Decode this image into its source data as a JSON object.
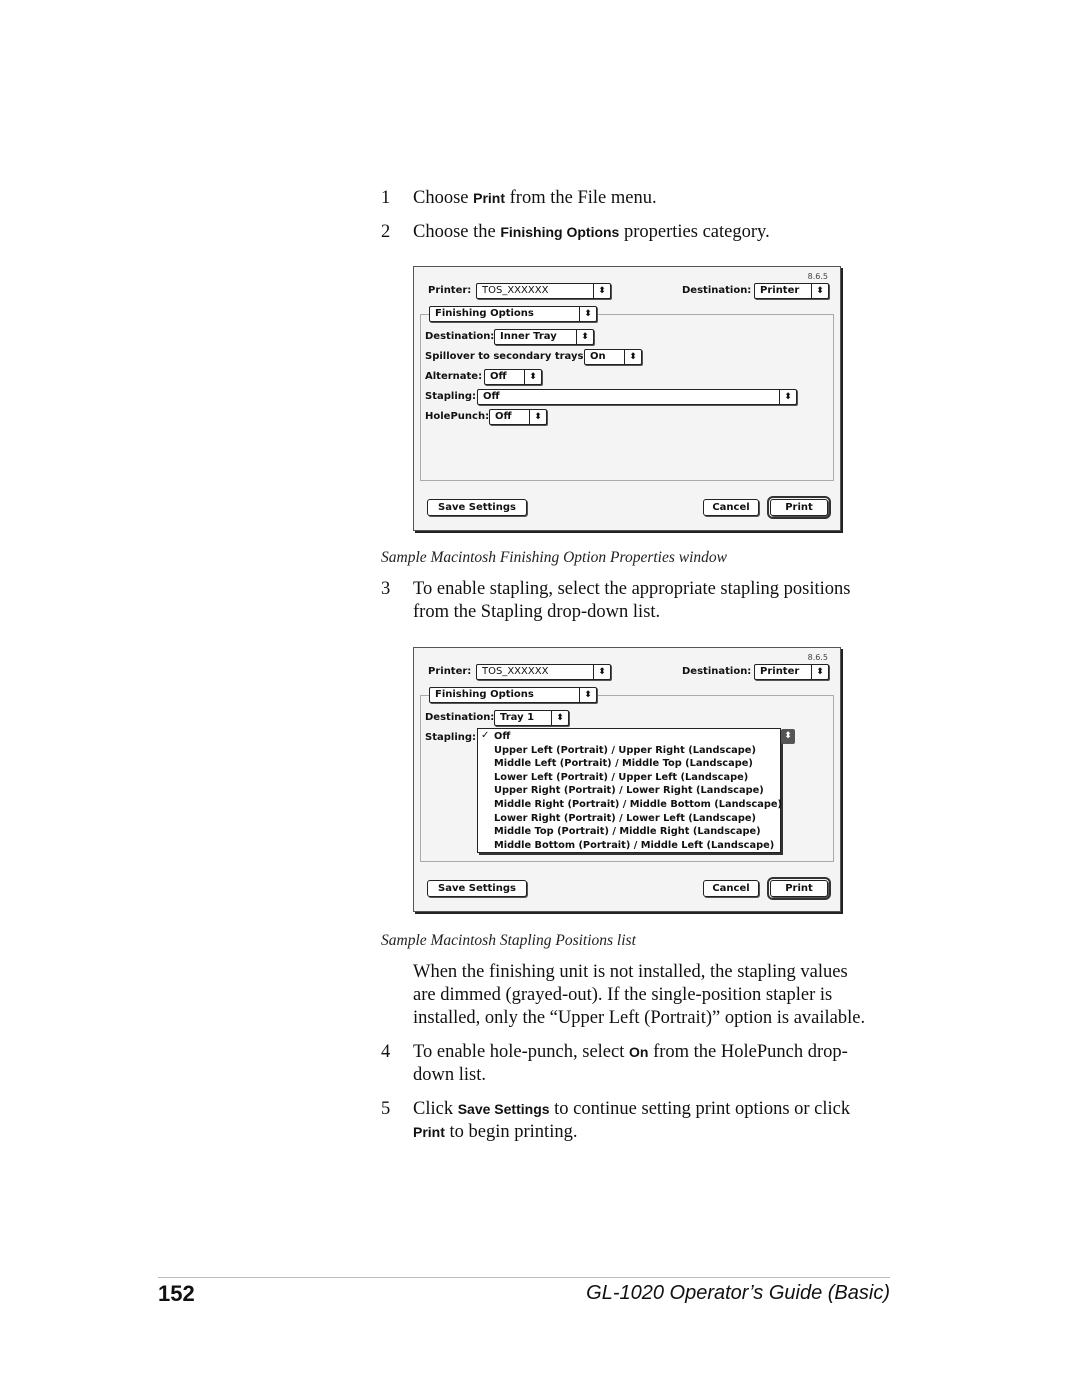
{
  "steps": [
    {
      "num": "1",
      "pre": "Choose ",
      "ui": "Print",
      "post": " from the File menu."
    },
    {
      "num": "2",
      "pre": "Choose the ",
      "ui": "Finishing Options",
      "post": " properties category."
    },
    {
      "num": "3",
      "line1": "To enable stapling, select the appropriate stapling positions",
      "line2": "from the Stapling drop-down list."
    },
    {
      "num": "4",
      "pre": "To enable hole-punch, select ",
      "ui": "On",
      "post": " from the HolePunch drop-",
      "line2": "down list."
    },
    {
      "num": "5",
      "pre": "Click ",
      "ui": "Save Settings",
      "post": " to continue setting print options or click",
      "line2_ui": "Print",
      "line2_post": " to begin printing."
    }
  ],
  "captions": {
    "first": "Sample Macintosh Finishing Option Properties window",
    "second": "Sample Macintosh Stapling Positions list"
  },
  "note": [
    "When the finishing unit is not installed, the stapling values",
    "are dimmed (grayed-out). If the single-position stapler is",
    "installed, only the “Upper Left (Portrait)” option is available."
  ],
  "dialog1": {
    "version": "8.6.5",
    "printer_label": "Printer:",
    "printer_value": "TOS_XXXXXX",
    "destination_label": "Destination:",
    "destination_value": "Printer",
    "category_value": "Finishing Options",
    "fields": {
      "destination_label": "Destination:",
      "destination_value": "Inner Tray",
      "spillover_label": "Spillover to secondary trays:",
      "spillover_value": "On",
      "alternate_label": "Alternate:",
      "alternate_value": "Off",
      "stapling_label": "Stapling:",
      "stapling_value": "Off",
      "holepunch_label": "HolePunch:",
      "holepunch_value": "Off"
    },
    "buttons": {
      "save": "Save Settings",
      "cancel": "Cancel",
      "print": "Print"
    }
  },
  "dialog2": {
    "version": "8.6.5",
    "printer_label": "Printer:",
    "printer_value": "TOS_XXXXXX",
    "destination_label": "Destination:",
    "destination_value": "Printer",
    "category_value": "Finishing Options",
    "fields": {
      "destination_label": "Destination:",
      "destination_value": "Tray 1",
      "stapling_label": "Stapling:"
    },
    "stapling_options": [
      "Off",
      "Upper Left (Portrait) / Upper Right (Landscape)",
      "Middle Left (Portrait) / Middle Top (Landscape)",
      "Lower Left (Portrait) / Upper Left (Landscape)",
      "Upper Right (Portrait) / Lower Right (Landscape)",
      "Middle Right (Portrait) / Middle Bottom (Landscape)",
      "Lower Right (Portrait) / Lower Left (Landscape)",
      "Middle Top (Portrait) / Middle Right (Landscape)",
      "Middle Bottom (Portrait) / Middle Left (Landscape)"
    ],
    "selected_option": "Off",
    "check_glyph": "✓",
    "buttons": {
      "save": "Save Settings",
      "cancel": "Cancel",
      "print": "Print"
    }
  },
  "icons": {
    "popup_arrows": "⬍"
  },
  "footer": {
    "page_number": "152",
    "title": "GL-1020 Operator’s Guide (Basic)"
  }
}
